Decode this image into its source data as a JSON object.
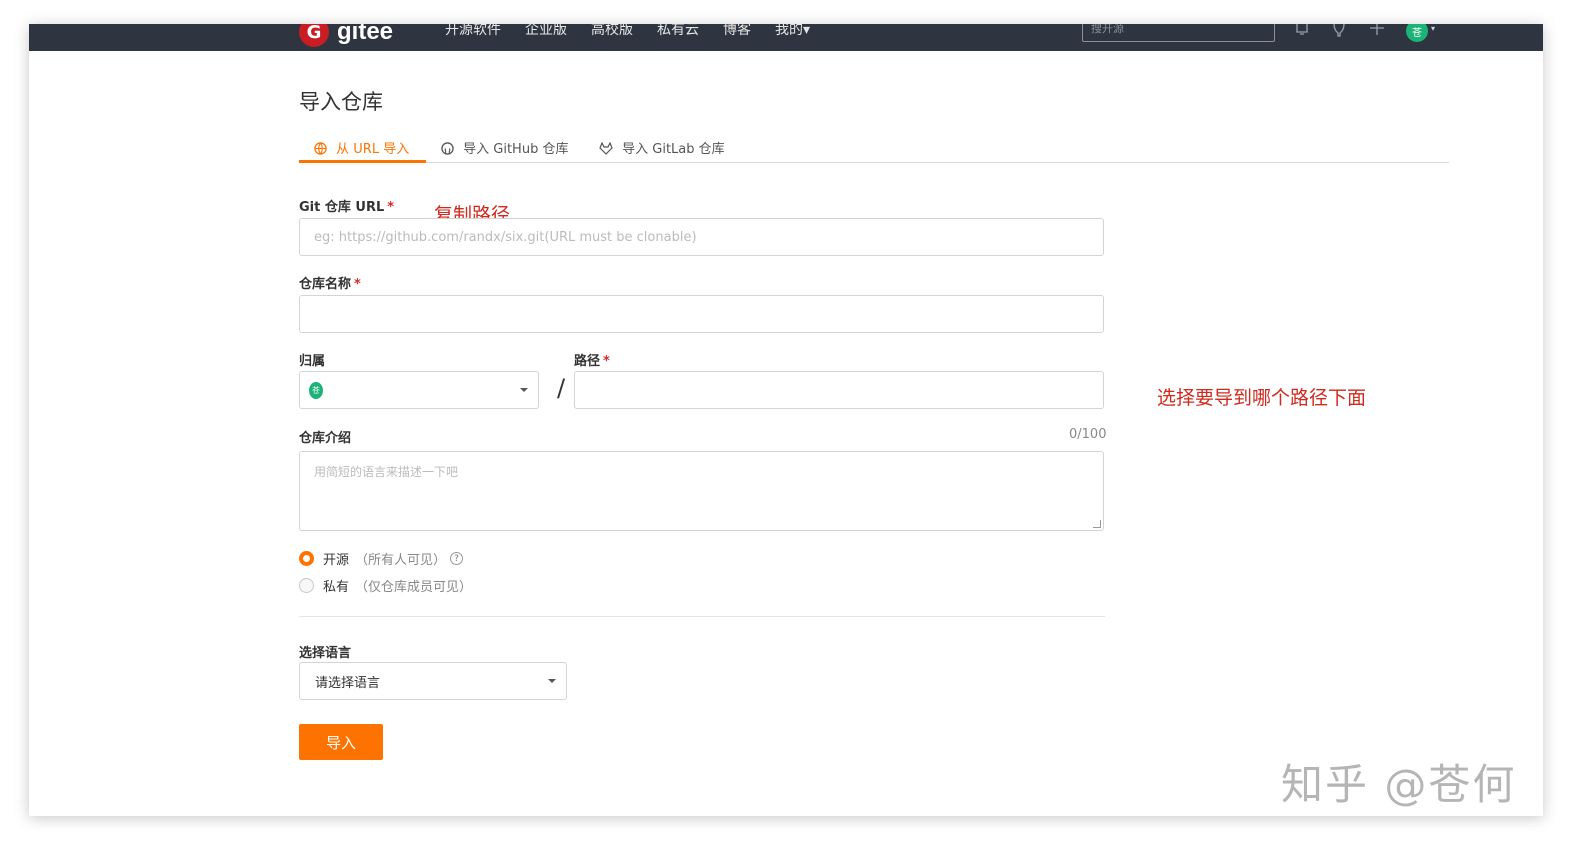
{
  "navbar": {
    "logo_badge": "G",
    "logo_text": "gitee",
    "items": [
      "开源软件",
      "企业版",
      "高校版",
      "私有云",
      "博客",
      "我的▾"
    ],
    "search_placeholder": "搜开源",
    "icons": [
      "bell-icon",
      "bulb-icon",
      "plus-icon"
    ],
    "avatar_text": "苍"
  },
  "page": {
    "title": "导入仓库"
  },
  "tabs": [
    {
      "label": "从 URL 导入",
      "icon": "globe-icon",
      "active": true
    },
    {
      "label": "导入 GitHub 仓库",
      "icon": "github-icon",
      "active": false
    },
    {
      "label": "导入 GitLab 仓库",
      "icon": "gitlab-icon",
      "active": false
    }
  ],
  "form": {
    "git_url_label": "Git 仓库 URL",
    "git_url_placeholder": "eg: https://github.com/randx/six.git(URL must be clonable)",
    "repo_name_label": "仓库名称",
    "owner_label": "归属",
    "owner_avatar": "苍",
    "path_label": "路径",
    "path_separator": "/",
    "desc_label": "仓库介绍",
    "desc_counter": "0/100",
    "desc_placeholder": "用简短的语言来描述一下吧",
    "required_mark": "*",
    "visibility": [
      {
        "label": "开源",
        "hint": "（所有人可见）",
        "selected": true,
        "help": "?"
      },
      {
        "label": "私有",
        "hint": "（仅仓库成员可见）",
        "selected": false
      }
    ],
    "language_label": "选择语言",
    "language_value": "请选择语言",
    "submit_label": "导入"
  },
  "annotations": {
    "copy_path": "复制路径",
    "choose_path": "选择要导到哪个路径下面"
  },
  "watermark": "知乎 @苍何",
  "colors": {
    "accent": "#fe7300",
    "navbar": "#2e3440",
    "annotation": "#d0291d",
    "brand_red": "#c71d23",
    "avatar_green": "#1bb378"
  }
}
